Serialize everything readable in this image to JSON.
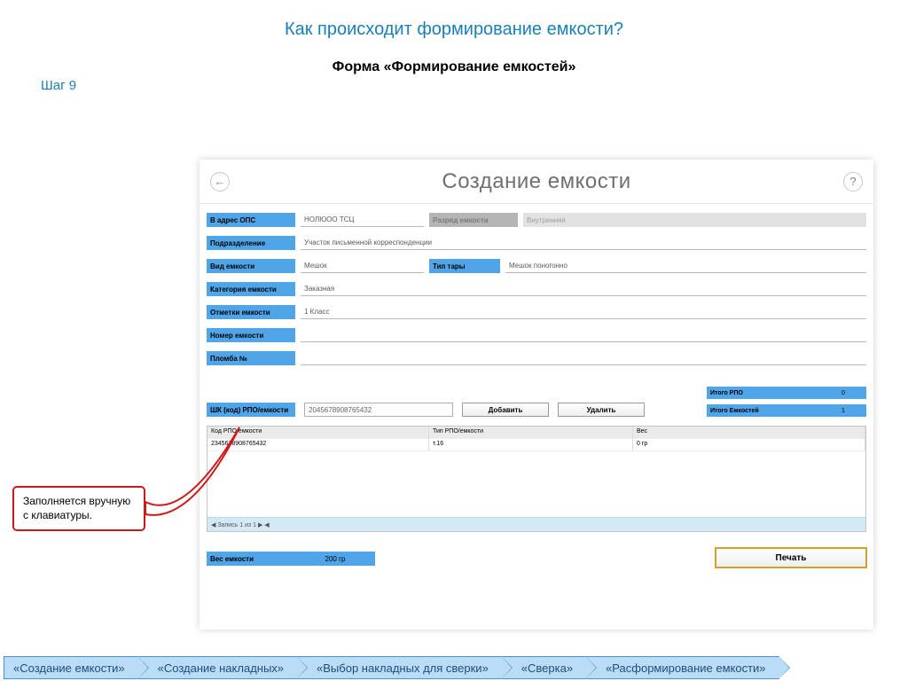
{
  "page": {
    "title": "Как происходит формирование емкости?",
    "subtitle": "Форма «Формирование емкостей»",
    "step": "Шаг 9"
  },
  "app": {
    "title": "Создание емкости"
  },
  "form": {
    "address_lbl": "В адрес ОПС",
    "address_val": "НОЛЮОО ТСЦ",
    "rank_lbl": "Разряд емкости",
    "rank_val": "Внутренняя",
    "dept_lbl": "Подразделение",
    "dept_val": "Участок письменной корреспонденции",
    "kind_lbl": "Вид емкости",
    "kind_val": "Мешок",
    "tare_lbl": "Тип тары",
    "tare_val": "Мешок поногонно",
    "cat_lbl": "Категория емкости",
    "cat_val": "Заказная",
    "marks_lbl": "Отметки емкости",
    "marks_val": "1 Класс",
    "num_lbl": "Номер емкости",
    "seal_lbl": "Пломба №"
  },
  "totals": {
    "rpo_lbl": "Итого РПО",
    "rpo_val": "0",
    "cont_lbl": "Итого Емкостей",
    "cont_val": "1"
  },
  "barcode": {
    "lbl": "ШК (код) РПО/емкости",
    "val": "2045678908765432",
    "add": "Добавить",
    "del": "Удалить"
  },
  "grid": {
    "h1": "Код РПО/емкости",
    "h2": "Тип РПО/емкости",
    "h3": "Вес",
    "r1c1": "2345678908765432",
    "r1c2": "т.16",
    "r1c3": "0 гр",
    "footer": "◀   Запись 1 из 1   ▶   ◀"
  },
  "weight": {
    "lbl": "Вес емкости",
    "val": "200 гр"
  },
  "print_btn": "Печать",
  "callout": "Заполняется вручную с клавиатуры.",
  "breadcrumb": [
    "«Создание емкости»",
    "«Создание накладных»",
    "«Выбор накладных для сверки»",
    "«Сверка»",
    "«Расформирование емкости»"
  ]
}
